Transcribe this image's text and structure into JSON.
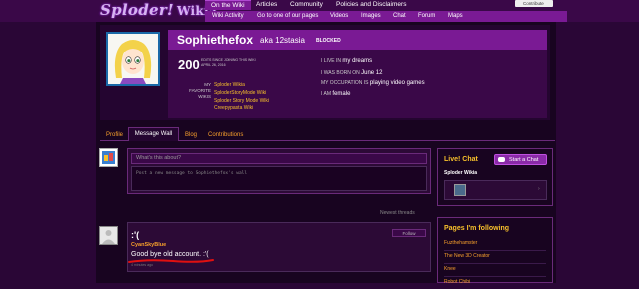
{
  "header": {
    "logo_text": "Sploder!",
    "logo_suffix": "Wikia",
    "tabs": [
      "On the Wiki",
      "Articles",
      "Community",
      "Policies and Disclaimers"
    ],
    "subnav": [
      "Wiki Activity",
      "Go to one of our pages",
      "Videos",
      "Images",
      "Chat",
      "Forum",
      "Maps"
    ],
    "contribute_label": "Contribute"
  },
  "profile": {
    "username": "Sophiethefox",
    "aka": "aka 12stasia",
    "status_badge": "BLOCKED",
    "edit_count": "200",
    "edits_label_1": "EDITS SINCE JOINING THIS WIKI",
    "edits_label_2": "APRIL 26, 2016",
    "favorite_wikis_label": "MY FAVORITE WIKIS",
    "favorite_wikis": [
      "Sploder Wikia",
      "SploderStoryMode Wiki",
      "Sploder Story Mode Wiki",
      "Creepypasta Wiki"
    ],
    "info": [
      {
        "label": "I LIVE IN",
        "value": "my dreams"
      },
      {
        "label": "I WAS BORN ON",
        "value": "June 12"
      },
      {
        "label": "MY OCCUPATION IS",
        "value": "playing video games"
      },
      {
        "label": "I AM",
        "value": "female"
      }
    ]
  },
  "profile_tabs": [
    "Profile",
    "Message Wall",
    "Blog",
    "Contributions"
  ],
  "wall": {
    "title_placeholder": "What's this about?",
    "message_placeholder": "Post a new message to Sophiethefox's wall",
    "sort_label": "Newest threads",
    "thread": {
      "title": ":'(",
      "author": "CyanSkyBlue",
      "body": "Good bye old account.   :'(",
      "time": "4 minutes ago",
      "follow_label": "Follow"
    }
  },
  "sidebar": {
    "chat_title": "Live! Chat",
    "start_chat_label": "Start a Chat",
    "chat_wiki_name": "Sploder Wikia",
    "chat_arrow": "›",
    "following_title": "Pages I'm following",
    "following": [
      "Fuzthehamster",
      "The New 3D Creator",
      "Knee",
      "Robot Chibi"
    ]
  },
  "colors": {
    "accent": "#7a1a94",
    "link": "#f7a02b",
    "highlight": "#f7c02b",
    "underline": "#e01010"
  }
}
